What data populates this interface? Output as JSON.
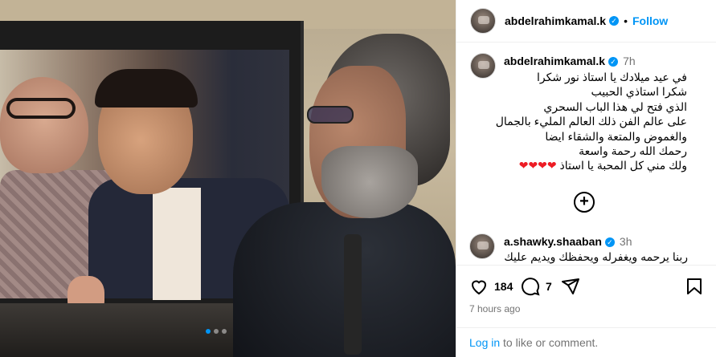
{
  "post": {
    "username": "abdelrahimkamal.k",
    "follow_label": "Follow",
    "separator": "•"
  },
  "caption": {
    "username": "abdelrahimkamal.k",
    "time": "7h",
    "text": "في عيد ميلادك يا استاذ نور شكرا\nشكرا استاذي الحبيب\nالذي فتح لي هذا الباب السحري\nعلى عالم الفن ذلك العالم المليء بالجمال\nوالغموض والمتعة والشقاء ايضا\nرحمك الله رحمة واسعة\nولك مني كل المحبة يا استاذ",
    "hearts": "❤❤❤❤"
  },
  "load_more_label": "+",
  "comment": {
    "username": "a.shawky.shaaban",
    "time": "3h",
    "text": "ربنا يرحمه ويغفرله ويحفظك ويديم عليك"
  },
  "actions": {
    "likes": "184",
    "comments": "7"
  },
  "posted_time": "7 hours ago",
  "login": {
    "link": "Log in",
    "rest": "to like or comment."
  },
  "icons": {
    "verified": "verified-icon",
    "like": "heart-icon",
    "comment": "comment-icon",
    "share": "share-icon",
    "save": "bookmark-icon",
    "load_more": "plus-circle-icon"
  },
  "colors": {
    "accent": "#0095f6",
    "heart": "#ed1c24",
    "muted": "#737373"
  },
  "carousel": {
    "count": 3,
    "active_index": 0
  }
}
